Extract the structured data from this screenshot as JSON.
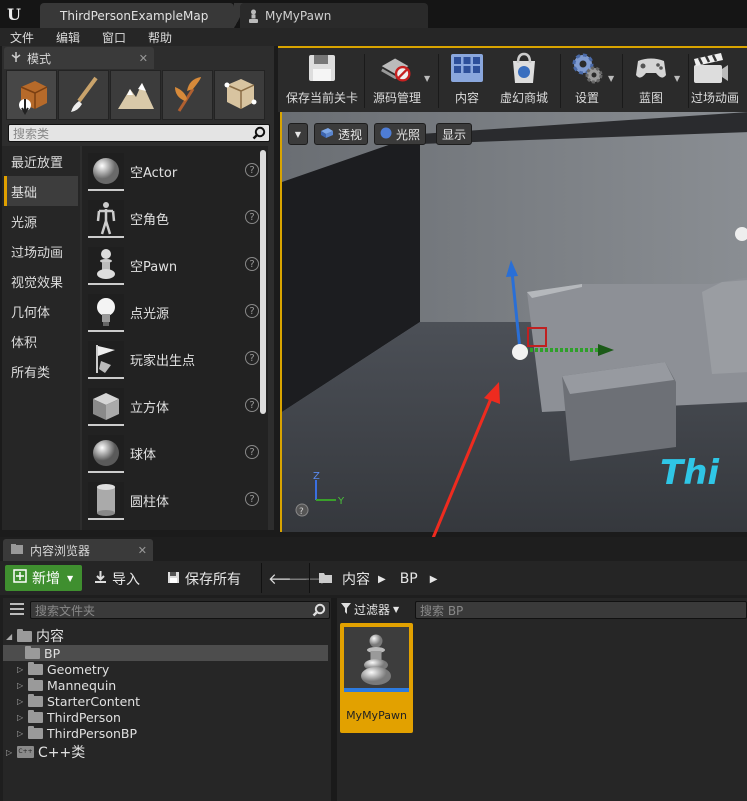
{
  "window": {
    "tabs": [
      {
        "label": "ThirdPersonExampleMap"
      },
      {
        "label": "MyMyPawn"
      }
    ]
  },
  "menu": {
    "items": [
      "文件",
      "编辑",
      "窗口",
      "帮助"
    ]
  },
  "modes_panel": {
    "title": "模式",
    "search_placeholder": "搜索类",
    "categories": [
      "最近放置",
      "基础",
      "光源",
      "过场动画",
      "视觉效果",
      "几何体",
      "体积",
      "所有类"
    ],
    "selected_category": "基础",
    "items": [
      {
        "label": "空Actor",
        "icon": "sphere-icon"
      },
      {
        "label": "空角色",
        "icon": "mannequin-icon"
      },
      {
        "label": "空Pawn",
        "icon": "pawn-icon"
      },
      {
        "label": "点光源",
        "icon": "lightbulb-icon"
      },
      {
        "label": "玩家出生点",
        "icon": "flag-icon"
      },
      {
        "label": "立方体",
        "icon": "cube-icon"
      },
      {
        "label": "球体",
        "icon": "sphere-icon"
      },
      {
        "label": "圆柱体",
        "icon": "cylinder-icon"
      }
    ]
  },
  "toolbar": {
    "buttons": [
      {
        "label": "保存当前关卡",
        "icon": "save-icon"
      },
      {
        "label": "源码管理",
        "icon": "source-control-icon"
      },
      {
        "label": "内容",
        "icon": "content-icon"
      },
      {
        "label": "虚幻商城",
        "icon": "marketplace-icon"
      },
      {
        "label": "设置",
        "icon": "settings-icon"
      },
      {
        "label": "蓝图",
        "icon": "blueprint-icon"
      },
      {
        "label": "过场动画",
        "icon": "cinematics-icon"
      }
    ]
  },
  "viewport": {
    "perspective_label": "透视",
    "lit_label": "光照",
    "show_label": "显示",
    "axis_z": "Z",
    "axis_y": "Y",
    "scene_text": "Thi"
  },
  "content_browser": {
    "title": "内容浏览器",
    "add_new_label": "新增",
    "import_label": "导入",
    "save_all_label": "保存所有",
    "path": [
      "内容",
      "BP"
    ],
    "folder_search_placeholder": "搜索文件夹",
    "filter_label": "过滤器",
    "asset_search_placeholder": "搜索 BP",
    "tree": {
      "root": "内容",
      "children": [
        "BP",
        "Geometry",
        "Mannequin",
        "StarterContent",
        "ThirdPerson",
        "ThirdPersonBP"
      ],
      "selected": "BP",
      "cpp": "C++类"
    },
    "assets": [
      {
        "label": "MyMyPawn"
      }
    ]
  },
  "colors": {
    "accent": "#d9a400",
    "add_button": "#3f8f2f",
    "annotation_arrow": "#ee2b1f",
    "asset_tile": "#e2a100"
  }
}
